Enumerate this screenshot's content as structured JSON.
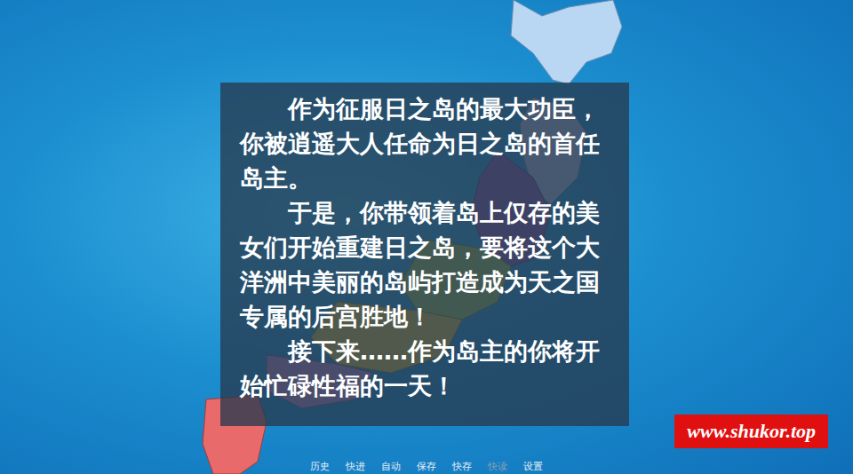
{
  "story": {
    "paragraphs": [
      "作为征服日之岛的最大功臣，你被逍遥大人任命为日之岛的首任岛主。",
      "于是，你带领着岛上仅存的美女们开始重建日之岛，要将这个大洋洲中美丽的岛屿打造成为天之国专属的后宫胜地！",
      "接下来……作为岛主的你将开始忙碌性福的一天！"
    ]
  },
  "menu": [
    {
      "label": "历史",
      "disabled": false
    },
    {
      "label": "快进",
      "disabled": false
    },
    {
      "label": "自动",
      "disabled": false
    },
    {
      "label": "保存",
      "disabled": false
    },
    {
      "label": "快存",
      "disabled": false
    },
    {
      "label": "快读",
      "disabled": true
    },
    {
      "label": "设置",
      "disabled": false
    }
  ],
  "watermark": "www.shukor.top"
}
